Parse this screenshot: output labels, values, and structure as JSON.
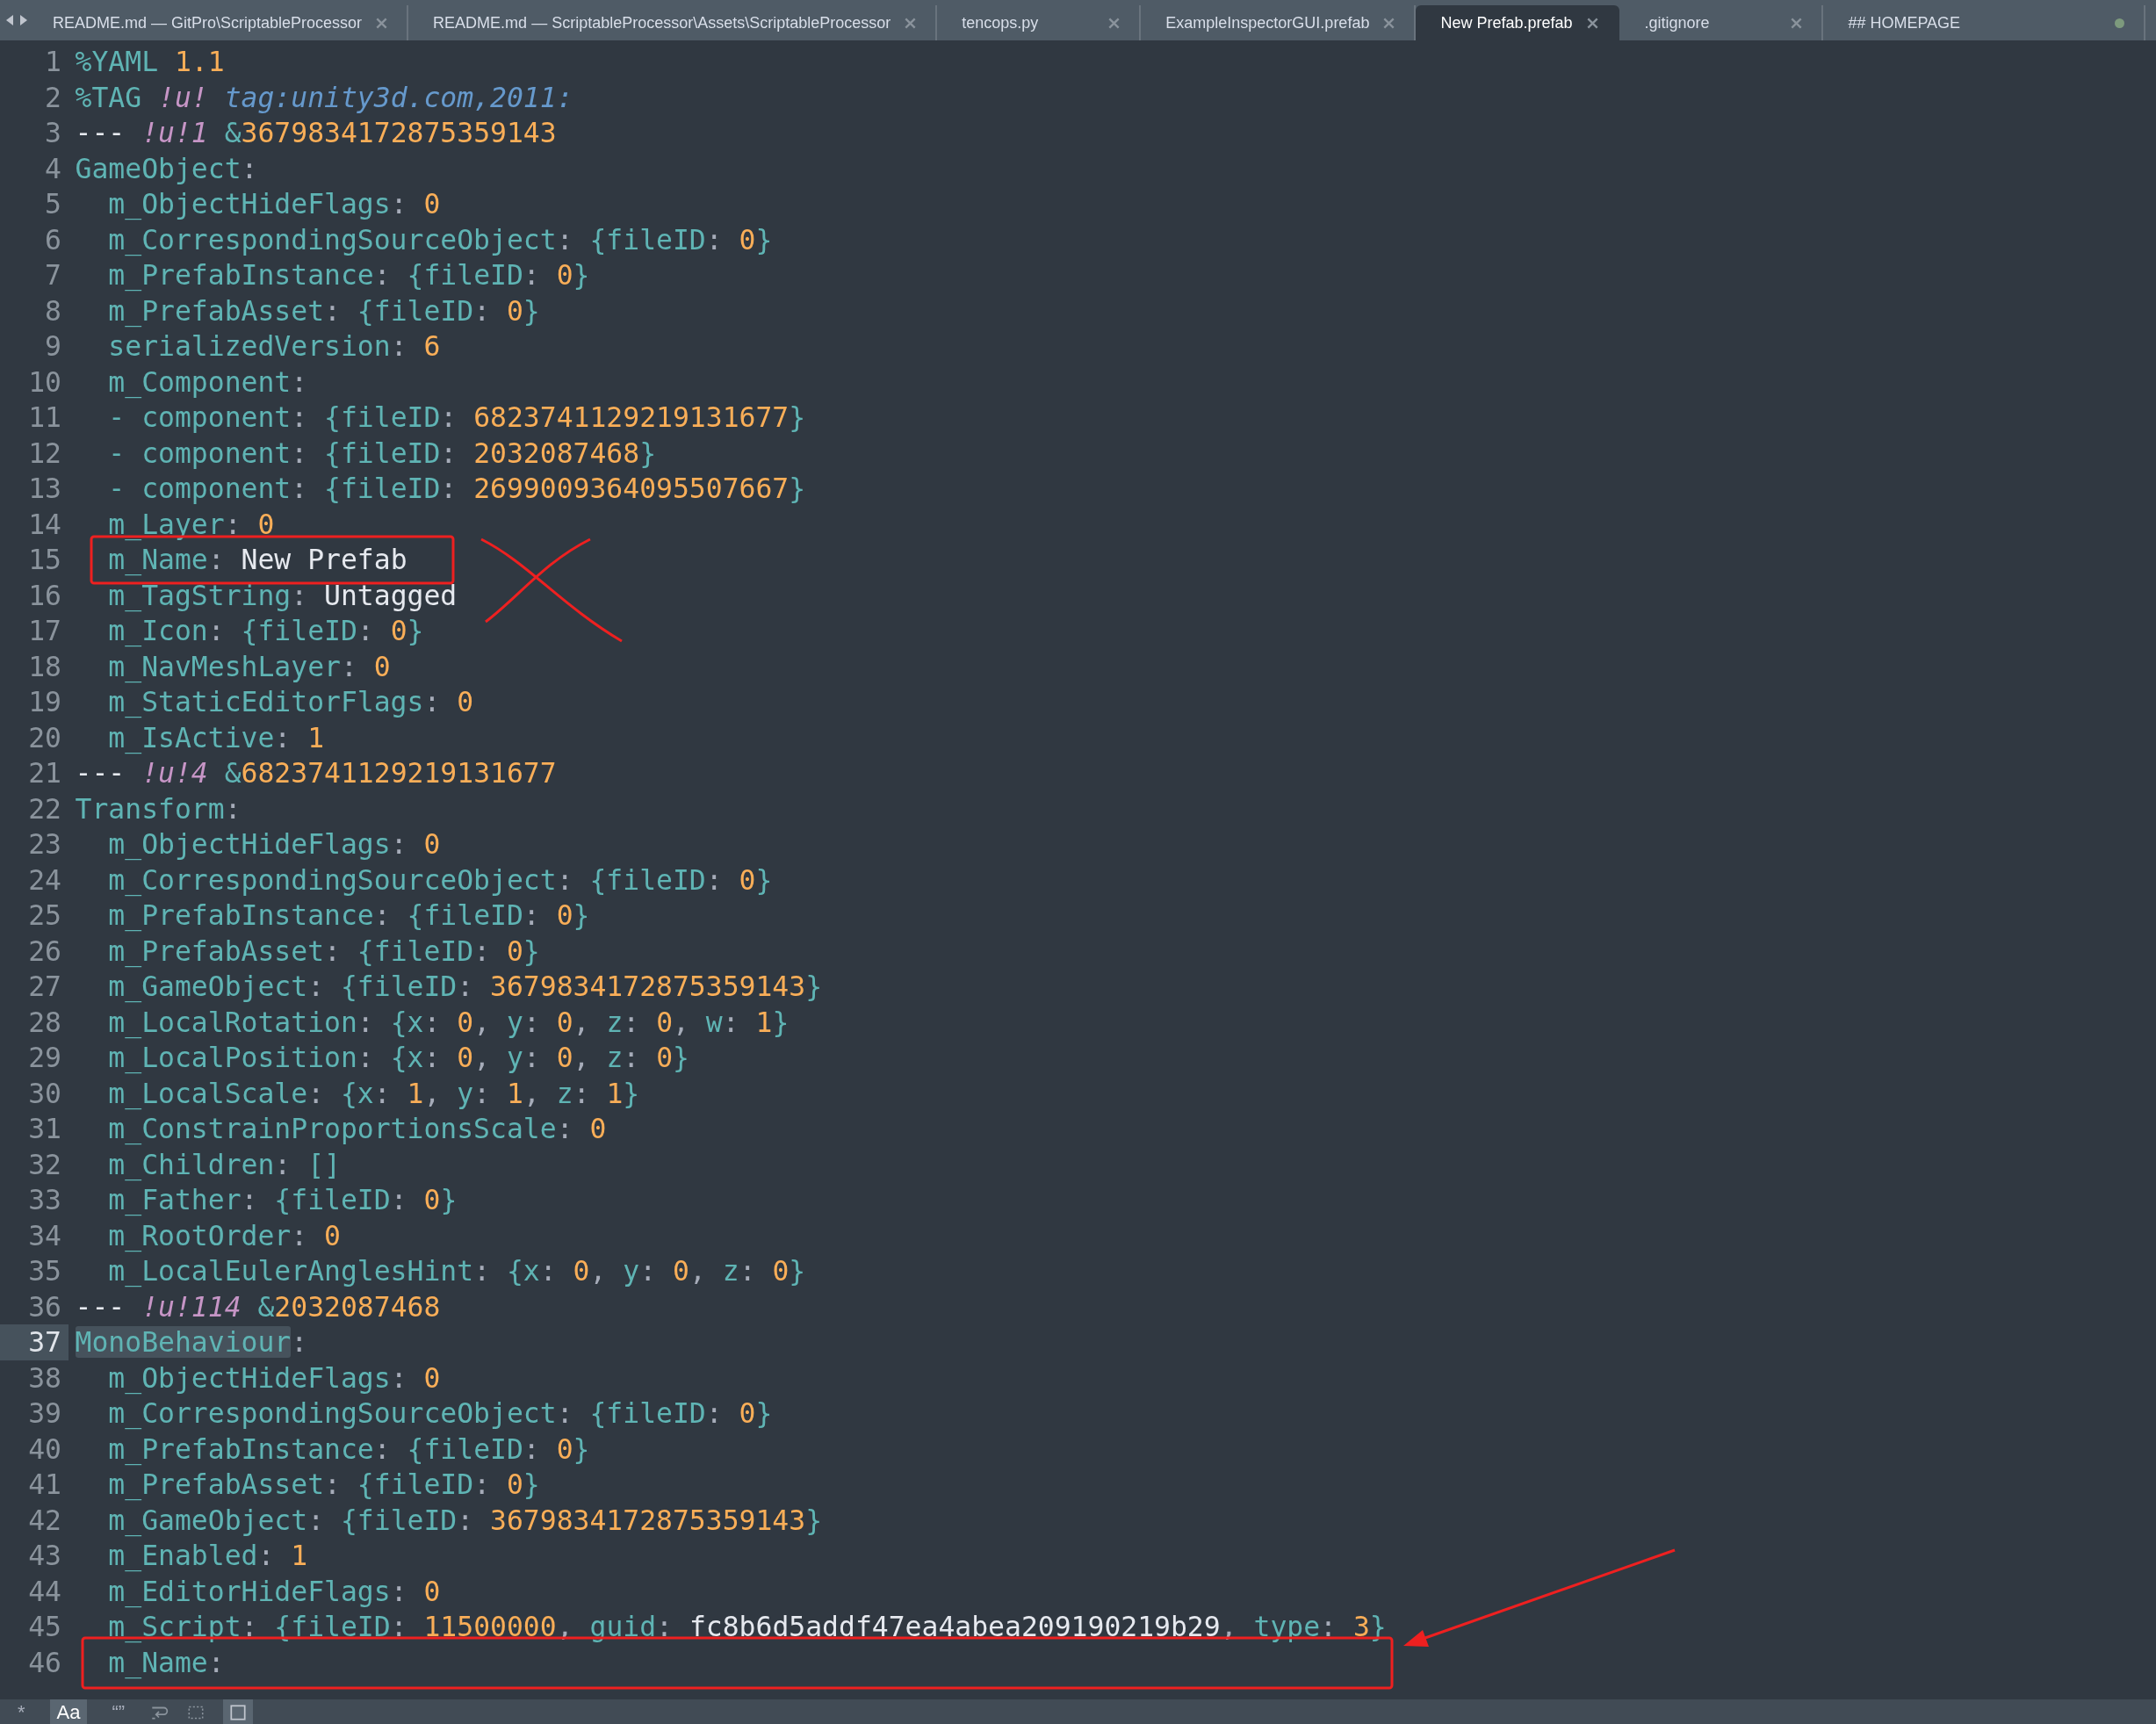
{
  "tabs": [
    {
      "label": "README.md — GitPro\\ScriptableProcessor",
      "selected": false,
      "dirty": false
    },
    {
      "label": "README.md — ScriptableProcessor\\Assets\\ScriptableProcessor",
      "selected": false,
      "dirty": false
    },
    {
      "label": "tencops.py",
      "selected": false,
      "dirty": false
    },
    {
      "label": "ExampleInspectorGUI.prefab",
      "selected": false,
      "dirty": false
    },
    {
      "label": "New Prefab.prefab",
      "selected": true,
      "dirty": false
    },
    {
      "label": ".gitignore",
      "selected": false,
      "dirty": false
    },
    {
      "label": "## HOMEPAGE",
      "selected": false,
      "dirty": true
    }
  ],
  "lines": [
    {
      "number": "1",
      "selected": false,
      "tokens": [
        {
          "kind": "key",
          "text": "%YAML "
        },
        {
          "kind": "number",
          "text": "1.1"
        }
      ]
    },
    {
      "number": "2",
      "selected": false,
      "tokens": [
        {
          "kind": "key",
          "text": "%TAG "
        },
        {
          "kind": "tag",
          "text": "!u! "
        },
        {
          "kind": "url",
          "text": "tag:unity3d.com,2011:"
        }
      ]
    },
    {
      "number": "3",
      "selected": false,
      "tokens": [
        {
          "kind": "plain",
          "text": "--- "
        },
        {
          "kind": "tag",
          "text": "!u!1 "
        },
        {
          "kind": "key",
          "text": "&"
        },
        {
          "kind": "number",
          "text": "3679834172875359143"
        }
      ]
    },
    {
      "number": "4",
      "selected": false,
      "tokens": [
        {
          "kind": "key",
          "text": "GameObject"
        },
        {
          "kind": "punct",
          "text": ":"
        }
      ],
      "children": [
        {
          "number": "5",
          "selected": false,
          "tokens": [
            {
              "kind": "key",
              "text": "m_ObjectHideFlags"
            },
            {
              "kind": "punct",
              "text": ": "
            },
            {
              "kind": "number",
              "text": "0"
            }
          ]
        },
        {
          "number": "6",
          "selected": false,
          "tokens": [
            {
              "kind": "key",
              "text": "m_CorrespondingSourceObject"
            },
            {
              "kind": "punct",
              "text": ": "
            },
            {
              "kind": "key",
              "text": "{fileID"
            },
            {
              "kind": "punct",
              "text": ": "
            },
            {
              "kind": "number",
              "text": "0"
            },
            {
              "kind": "key",
              "text": "}"
            }
          ]
        },
        {
          "number": "7",
          "selected": false,
          "tokens": [
            {
              "kind": "key",
              "text": "m_PrefabInstance"
            },
            {
              "kind": "punct",
              "text": ": "
            },
            {
              "kind": "key",
              "text": "{fileID"
            },
            {
              "kind": "punct",
              "text": ": "
            },
            {
              "kind": "number",
              "text": "0"
            },
            {
              "kind": "key",
              "text": "}"
            }
          ]
        },
        {
          "number": "8",
          "selected": false,
          "tokens": [
            {
              "kind": "key",
              "text": "m_PrefabAsset"
            },
            {
              "kind": "punct",
              "text": ": "
            },
            {
              "kind": "key",
              "text": "{fileID"
            },
            {
              "kind": "punct",
              "text": ": "
            },
            {
              "kind": "number",
              "text": "0"
            },
            {
              "kind": "key",
              "text": "}"
            }
          ]
        },
        {
          "number": "9",
          "selected": false,
          "tokens": [
            {
              "kind": "key",
              "text": "serializedVersion"
            },
            {
              "kind": "punct",
              "text": ": "
            },
            {
              "kind": "number",
              "text": "6"
            }
          ]
        },
        {
          "number": "10",
          "selected": false,
          "tokens": [
            {
              "kind": "key",
              "text": "m_Component"
            },
            {
              "kind": "punct",
              "text": ":"
            }
          ]
        },
        {
          "number": "11",
          "selected": false,
          "tokens": [
            {
              "kind": "key",
              "text": "- component"
            },
            {
              "kind": "punct",
              "text": ": "
            },
            {
              "kind": "key",
              "text": "{fileID"
            },
            {
              "kind": "punct",
              "text": ": "
            },
            {
              "kind": "number",
              "text": "6823741129219131677"
            },
            {
              "kind": "key",
              "text": "}"
            }
          ]
        },
        {
          "number": "12",
          "selected": false,
          "tokens": [
            {
              "kind": "key",
              "text": "- component"
            },
            {
              "kind": "punct",
              "text": ": "
            },
            {
              "kind": "key",
              "text": "{fileID"
            },
            {
              "kind": "punct",
              "text": ": "
            },
            {
              "kind": "number",
              "text": "2032087468"
            },
            {
              "kind": "key",
              "text": "}"
            }
          ]
        },
        {
          "number": "13",
          "selected": false,
          "tokens": [
            {
              "kind": "key",
              "text": "- component"
            },
            {
              "kind": "punct",
              "text": ": "
            },
            {
              "kind": "key",
              "text": "{fileID"
            },
            {
              "kind": "punct",
              "text": ": "
            },
            {
              "kind": "number",
              "text": "2699009364095507667"
            },
            {
              "kind": "key",
              "text": "}"
            }
          ]
        },
        {
          "number": "14",
          "selected": false,
          "tokens": [
            {
              "kind": "key",
              "text": "m_Layer"
            },
            {
              "kind": "punct",
              "text": ": "
            },
            {
              "kind": "number",
              "text": "0"
            }
          ]
        },
        {
          "number": "15",
          "selected": false,
          "tokens": [
            {
              "kind": "key",
              "text": "m_Name"
            },
            {
              "kind": "punct",
              "text": ": "
            },
            {
              "kind": "plain",
              "text": "New Prefab"
            }
          ]
        },
        {
          "number": "16",
          "selected": false,
          "tokens": [
            {
              "kind": "key",
              "text": "m_TagString"
            },
            {
              "kind": "punct",
              "text": ": "
            },
            {
              "kind": "plain",
              "text": "Untagged"
            }
          ]
        },
        {
          "number": "17",
          "selected": false,
          "tokens": [
            {
              "kind": "key",
              "text": "m_Icon"
            },
            {
              "kind": "punct",
              "text": ": "
            },
            {
              "kind": "key",
              "text": "{fileID"
            },
            {
              "kind": "punct",
              "text": ": "
            },
            {
              "kind": "number",
              "text": "0"
            },
            {
              "kind": "key",
              "text": "}"
            }
          ]
        },
        {
          "number": "18",
          "selected": false,
          "tokens": [
            {
              "kind": "key",
              "text": "m_NavMeshLayer"
            },
            {
              "kind": "punct",
              "text": ": "
            },
            {
              "kind": "number",
              "text": "0"
            }
          ]
        },
        {
          "number": "19",
          "selected": false,
          "tokens": [
            {
              "kind": "key",
              "text": "m_StaticEditorFlags"
            },
            {
              "kind": "punct",
              "text": ": "
            },
            {
              "kind": "number",
              "text": "0"
            }
          ]
        },
        {
          "number": "20",
          "selected": false,
          "tokens": [
            {
              "kind": "key",
              "text": "m_IsActive"
            },
            {
              "kind": "punct",
              "text": ": "
            },
            {
              "kind": "number",
              "text": "1"
            }
          ]
        }
      ]
    },
    {
      "number": "21",
      "selected": false,
      "tokens": [
        {
          "kind": "plain",
          "text": "--- "
        },
        {
          "kind": "tag",
          "text": "!u!4 "
        },
        {
          "kind": "key",
          "text": "&"
        },
        {
          "kind": "number",
          "text": "6823741129219131677"
        }
      ]
    },
    {
      "number": "22",
      "selected": false,
      "tokens": [
        {
          "kind": "key",
          "text": "Transform"
        },
        {
          "kind": "punct",
          "text": ":"
        }
      ],
      "children": [
        {
          "number": "23",
          "selected": false,
          "tokens": [
            {
              "kind": "key",
              "text": "m_ObjectHideFlags"
            },
            {
              "kind": "punct",
              "text": ": "
            },
            {
              "kind": "number",
              "text": "0"
            }
          ]
        },
        {
          "number": "24",
          "selected": false,
          "tokens": [
            {
              "kind": "key",
              "text": "m_CorrespondingSourceObject"
            },
            {
              "kind": "punct",
              "text": ": "
            },
            {
              "kind": "key",
              "text": "{fileID"
            },
            {
              "kind": "punct",
              "text": ": "
            },
            {
              "kind": "number",
              "text": "0"
            },
            {
              "kind": "key",
              "text": "}"
            }
          ]
        },
        {
          "number": "25",
          "selected": false,
          "tokens": [
            {
              "kind": "key",
              "text": "m_PrefabInstance"
            },
            {
              "kind": "punct",
              "text": ": "
            },
            {
              "kind": "key",
              "text": "{fileID"
            },
            {
              "kind": "punct",
              "text": ": "
            },
            {
              "kind": "number",
              "text": "0"
            },
            {
              "kind": "key",
              "text": "}"
            }
          ]
        },
        {
          "number": "26",
          "selected": false,
          "tokens": [
            {
              "kind": "key",
              "text": "m_PrefabAsset"
            },
            {
              "kind": "punct",
              "text": ": "
            },
            {
              "kind": "key",
              "text": "{fileID"
            },
            {
              "kind": "punct",
              "text": ": "
            },
            {
              "kind": "number",
              "text": "0"
            },
            {
              "kind": "key",
              "text": "}"
            }
          ]
        },
        {
          "number": "27",
          "selected": false,
          "tokens": [
            {
              "kind": "key",
              "text": "m_GameObject"
            },
            {
              "kind": "punct",
              "text": ": "
            },
            {
              "kind": "key",
              "text": "{fileID"
            },
            {
              "kind": "punct",
              "text": ": "
            },
            {
              "kind": "number",
              "text": "3679834172875359143"
            },
            {
              "kind": "key",
              "text": "}"
            }
          ]
        },
        {
          "number": "28",
          "selected": false,
          "tokens": [
            {
              "kind": "key",
              "text": "m_LocalRotation"
            },
            {
              "kind": "punct",
              "text": ": "
            },
            {
              "kind": "key",
              "text": "{x"
            },
            {
              "kind": "punct",
              "text": ": "
            },
            {
              "kind": "number",
              "text": "0"
            },
            {
              "kind": "punct",
              "text": ", "
            },
            {
              "kind": "key",
              "text": "y"
            },
            {
              "kind": "punct",
              "text": ": "
            },
            {
              "kind": "number",
              "text": "0"
            },
            {
              "kind": "punct",
              "text": ", "
            },
            {
              "kind": "key",
              "text": "z"
            },
            {
              "kind": "punct",
              "text": ": "
            },
            {
              "kind": "number",
              "text": "0"
            },
            {
              "kind": "punct",
              "text": ", "
            },
            {
              "kind": "key",
              "text": "w"
            },
            {
              "kind": "punct",
              "text": ": "
            },
            {
              "kind": "number",
              "text": "1"
            },
            {
              "kind": "key",
              "text": "}"
            }
          ]
        },
        {
          "number": "29",
          "selected": false,
          "tokens": [
            {
              "kind": "key",
              "text": "m_LocalPosition"
            },
            {
              "kind": "punct",
              "text": ": "
            },
            {
              "kind": "key",
              "text": "{x"
            },
            {
              "kind": "punct",
              "text": ": "
            },
            {
              "kind": "number",
              "text": "0"
            },
            {
              "kind": "punct",
              "text": ", "
            },
            {
              "kind": "key",
              "text": "y"
            },
            {
              "kind": "punct",
              "text": ": "
            },
            {
              "kind": "number",
              "text": "0"
            },
            {
              "kind": "punct",
              "text": ", "
            },
            {
              "kind": "key",
              "text": "z"
            },
            {
              "kind": "punct",
              "text": ": "
            },
            {
              "kind": "number",
              "text": "0"
            },
            {
              "kind": "key",
              "text": "}"
            }
          ]
        },
        {
          "number": "30",
          "selected": false,
          "tokens": [
            {
              "kind": "key",
              "text": "m_LocalScale"
            },
            {
              "kind": "punct",
              "text": ": "
            },
            {
              "kind": "key",
              "text": "{x"
            },
            {
              "kind": "punct",
              "text": ": "
            },
            {
              "kind": "number",
              "text": "1"
            },
            {
              "kind": "punct",
              "text": ", "
            },
            {
              "kind": "key",
              "text": "y"
            },
            {
              "kind": "punct",
              "text": ": "
            },
            {
              "kind": "number",
              "text": "1"
            },
            {
              "kind": "punct",
              "text": ", "
            },
            {
              "kind": "key",
              "text": "z"
            },
            {
              "kind": "punct",
              "text": ": "
            },
            {
              "kind": "number",
              "text": "1"
            },
            {
              "kind": "key",
              "text": "}"
            }
          ]
        },
        {
          "number": "31",
          "selected": false,
          "tokens": [
            {
              "kind": "key",
              "text": "m_ConstrainProportionsScale"
            },
            {
              "kind": "punct",
              "text": ": "
            },
            {
              "kind": "number",
              "text": "0"
            }
          ]
        },
        {
          "number": "32",
          "selected": false,
          "tokens": [
            {
              "kind": "key",
              "text": "m_Children"
            },
            {
              "kind": "punct",
              "text": ": "
            },
            {
              "kind": "key",
              "text": "[]"
            }
          ]
        },
        {
          "number": "33",
          "selected": false,
          "tokens": [
            {
              "kind": "key",
              "text": "m_Father"
            },
            {
              "kind": "punct",
              "text": ": "
            },
            {
              "kind": "key",
              "text": "{fileID"
            },
            {
              "kind": "punct",
              "text": ": "
            },
            {
              "kind": "number",
              "text": "0"
            },
            {
              "kind": "key",
              "text": "}"
            }
          ]
        },
        {
          "number": "34",
          "selected": false,
          "tokens": [
            {
              "kind": "key",
              "text": "m_RootOrder"
            },
            {
              "kind": "punct",
              "text": ": "
            },
            {
              "kind": "number",
              "text": "0"
            }
          ]
        },
        {
          "number": "35",
          "selected": false,
          "tokens": [
            {
              "kind": "key",
              "text": "m_LocalEulerAnglesHint"
            },
            {
              "kind": "punct",
              "text": ": "
            },
            {
              "kind": "key",
              "text": "{x"
            },
            {
              "kind": "punct",
              "text": ": "
            },
            {
              "kind": "number",
              "text": "0"
            },
            {
              "kind": "punct",
              "text": ", "
            },
            {
              "kind": "key",
              "text": "y"
            },
            {
              "kind": "punct",
              "text": ": "
            },
            {
              "kind": "number",
              "text": "0"
            },
            {
              "kind": "punct",
              "text": ", "
            },
            {
              "kind": "key",
              "text": "z"
            },
            {
              "kind": "punct",
              "text": ": "
            },
            {
              "kind": "number",
              "text": "0"
            },
            {
              "kind": "key",
              "text": "}"
            }
          ]
        }
      ]
    },
    {
      "number": "36",
      "selected": false,
      "tokens": [
        {
          "kind": "plain",
          "text": "--- "
        },
        {
          "kind": "tag",
          "text": "!u!114 "
        },
        {
          "kind": "key",
          "text": "&"
        },
        {
          "kind": "number",
          "text": "2032087468"
        }
      ]
    },
    {
      "number": "37",
      "selected": true,
      "tokens": [
        {
          "kind": "match",
          "text": "MonoBehaviour"
        },
        {
          "kind": "punct",
          "text": ":"
        }
      ],
      "children": [
        {
          "number": "38",
          "selected": false,
          "tokens": [
            {
              "kind": "key",
              "text": "m_ObjectHideFlags"
            },
            {
              "kind": "punct",
              "text": ": "
            },
            {
              "kind": "number",
              "text": "0"
            }
          ]
        },
        {
          "number": "39",
          "selected": false,
          "tokens": [
            {
              "kind": "key",
              "text": "m_CorrespondingSourceObject"
            },
            {
              "kind": "punct",
              "text": ": "
            },
            {
              "kind": "key",
              "text": "{fileID"
            },
            {
              "kind": "punct",
              "text": ": "
            },
            {
              "kind": "number",
              "text": "0"
            },
            {
              "kind": "key",
              "text": "}"
            }
          ]
        },
        {
          "number": "40",
          "selected": false,
          "tokens": [
            {
              "kind": "key",
              "text": "m_PrefabInstance"
            },
            {
              "kind": "punct",
              "text": ": "
            },
            {
              "kind": "key",
              "text": "{fileID"
            },
            {
              "kind": "punct",
              "text": ": "
            },
            {
              "kind": "number",
              "text": "0"
            },
            {
              "kind": "key",
              "text": "}"
            }
          ]
        },
        {
          "number": "41",
          "selected": false,
          "tokens": [
            {
              "kind": "key",
              "text": "m_PrefabAsset"
            },
            {
              "kind": "punct",
              "text": ": "
            },
            {
              "kind": "key",
              "text": "{fileID"
            },
            {
              "kind": "punct",
              "text": ": "
            },
            {
              "kind": "number",
              "text": "0"
            },
            {
              "kind": "key",
              "text": "}"
            }
          ]
        },
        {
          "number": "42",
          "selected": false,
          "tokens": [
            {
              "kind": "key",
              "text": "m_GameObject"
            },
            {
              "kind": "punct",
              "text": ": "
            },
            {
              "kind": "key",
              "text": "{fileID"
            },
            {
              "kind": "punct",
              "text": ": "
            },
            {
              "kind": "number",
              "text": "3679834172875359143"
            },
            {
              "kind": "key",
              "text": "}"
            }
          ]
        },
        {
          "number": "43",
          "selected": false,
          "tokens": [
            {
              "kind": "key",
              "text": "m_Enabled"
            },
            {
              "kind": "punct",
              "text": ": "
            },
            {
              "kind": "number",
              "text": "1"
            }
          ]
        },
        {
          "number": "44",
          "selected": false,
          "tokens": [
            {
              "kind": "key",
              "text": "m_EditorHideFlags"
            },
            {
              "kind": "punct",
              "text": ": "
            },
            {
              "kind": "number",
              "text": "0"
            }
          ]
        },
        {
          "number": "45",
          "selected": false,
          "tokens": [
            {
              "kind": "key",
              "text": "m_Script"
            },
            {
              "kind": "punct",
              "text": ": "
            },
            {
              "kind": "key",
              "text": "{fileID"
            },
            {
              "kind": "punct",
              "text": ": "
            },
            {
              "kind": "number",
              "text": "11500000"
            },
            {
              "kind": "punct",
              "text": ", "
            },
            {
              "kind": "key",
              "text": "guid"
            },
            {
              "kind": "punct",
              "text": ": "
            },
            {
              "kind": "plain",
              "text": "fc8b6d5addf47ea4abea209190219b29"
            },
            {
              "kind": "punct",
              "text": ", "
            },
            {
              "kind": "key",
              "text": "type"
            },
            {
              "kind": "punct",
              "text": ": "
            },
            {
              "kind": "number",
              "text": "3"
            },
            {
              "kind": "key",
              "text": "}"
            }
          ]
        },
        {
          "number": "46",
          "selected": false,
          "tokens": [
            {
              "kind": "key",
              "text": "m_Name"
            },
            {
              "kind": "punct",
              "text": ":"
            }
          ]
        }
      ]
    }
  ],
  "status_bar": {
    "toggles": [
      {
        "label": "*",
        "selected": false
      },
      {
        "label": "Aa",
        "selected": true
      },
      {
        "label": "“”",
        "selected": false
      }
    ]
  }
}
